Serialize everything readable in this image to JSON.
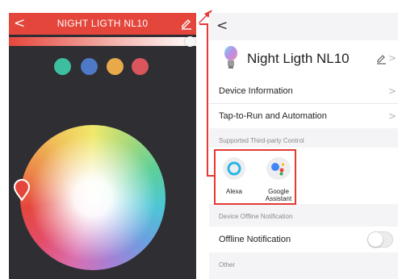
{
  "left_panel": {
    "back_glyph": "<",
    "title": "NIGHT LIGTH NL10",
    "edit_icon": "pencil-icon",
    "swatch_colors": [
      "#3dbf9f",
      "#4d79c7",
      "#e8a94a",
      "#d9565c"
    ],
    "colors": {
      "header": "#e5463c",
      "background": "#2e2e33"
    }
  },
  "right_panel": {
    "back_glyph": "<",
    "device_name": "Night Ligth NL10",
    "menu_items": [
      {
        "label": "Device Information",
        "chevron": ">"
      },
      {
        "label": "Tap-to-Run and Automation",
        "chevron": ">"
      }
    ],
    "sections": {
      "third_party": "Supported Third-party Control",
      "offline": "Device Offline Notification",
      "other": "Other"
    },
    "assistants": [
      {
        "label": "Alexa",
        "icon": "alexa-icon"
      },
      {
        "label": "Google\nAssistant",
        "icon": "google-assistant-icon"
      }
    ],
    "offline_notification": {
      "label": "Offline Notification",
      "enabled": false
    },
    "edit_chevron": ">"
  },
  "annotation": {
    "color": "#e53935"
  }
}
